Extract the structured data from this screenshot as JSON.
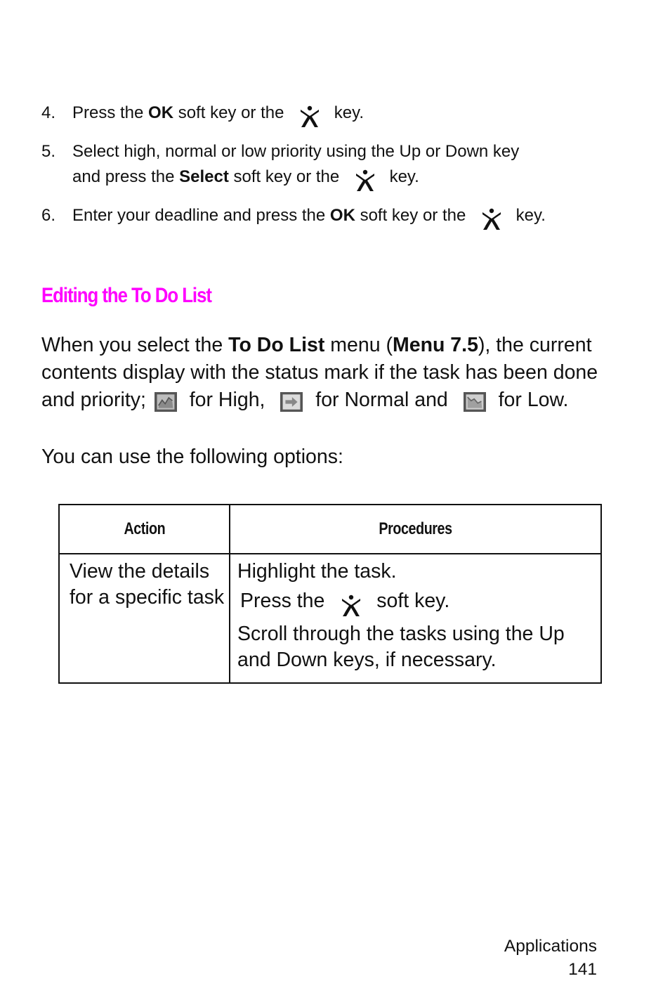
{
  "steps": [
    {
      "num": "4.",
      "lines": [
        {
          "pre": "Press the ",
          "bold": "OK",
          "mid": " soft key or the ",
          "icon": "center-key-icon",
          "post": " key."
        }
      ]
    },
    {
      "num": "5.",
      "line1": "Select high, normal or low priority using the Up or Down key",
      "lines": [
        {
          "pre": "and press the ",
          "bold": "Select",
          "mid": " soft key or the ",
          "icon": "center-key-icon",
          "post": " key."
        }
      ]
    },
    {
      "num": "6.",
      "lines": [
        {
          "pre": "Enter your deadline and press the ",
          "bold": "OK",
          "mid": " soft key or the ",
          "icon": "center-key-icon",
          "post": " key."
        }
      ]
    }
  ],
  "section": {
    "heading": "Editing the To Do List",
    "heading_color": "#ff00ff",
    "para": {
      "t1": "When you select the ",
      "b1": "To Do List",
      "t2": " menu (",
      "b2": "Menu 7.5",
      "t3": "), the current contents display with the status mark if the task has been done and priority; ",
      "t4": " for High, ",
      "t5": " for Normal and ",
      "t6": " for Low."
    },
    "icons": {
      "high": "priority-high-icon",
      "normal": "priority-normal-icon",
      "low": "priority-low-icon"
    },
    "options_intro": "You can use the following options:"
  },
  "table": {
    "headers": [
      "Action",
      "Procedures"
    ],
    "rows": [
      {
        "action": "View the details for a specific task",
        "procedures": {
          "line1": "Highlight the task.",
          "line2_pre": "Press the ",
          "line2_post": " soft key.",
          "line3": "Scroll through the tasks using the Up and Down keys, if necessary."
        }
      }
    ]
  },
  "footer": {
    "section": "Applications",
    "page": "141"
  }
}
